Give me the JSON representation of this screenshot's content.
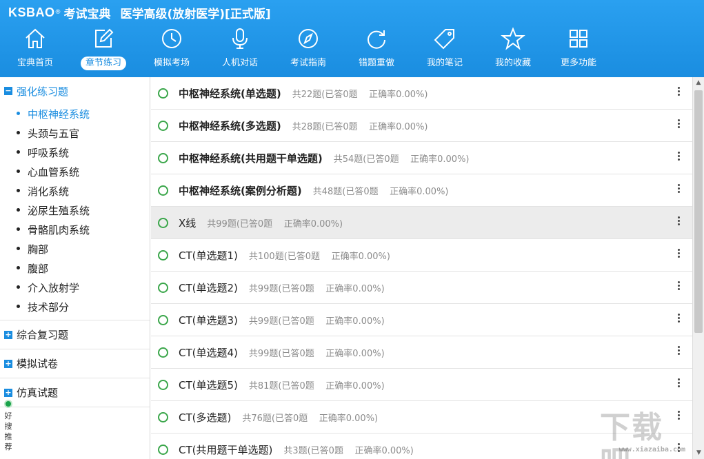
{
  "brand": {
    "logo": "KSBAO",
    "logo_sup": "®",
    "logo_cn": "考试宝典",
    "app_title": "医学高级(放射医学)[正式版]"
  },
  "nav": [
    {
      "label": "宝典首页",
      "icon": "home-icon"
    },
    {
      "label": "章节练习",
      "icon": "edit-icon"
    },
    {
      "label": "模拟考场",
      "icon": "clock-icon"
    },
    {
      "label": "人机对话",
      "icon": "microphone-icon"
    },
    {
      "label": "考试指南",
      "icon": "compass-icon"
    },
    {
      "label": "错题重做",
      "icon": "refresh-icon"
    },
    {
      "label": "我的笔记",
      "icon": "tag-icon"
    },
    {
      "label": "我的收藏",
      "icon": "star-icon"
    },
    {
      "label": "更多功能",
      "icon": "grid-icon"
    }
  ],
  "nav_active": "章节练习",
  "sidebar": {
    "groups": [
      {
        "title": "强化练习题",
        "toggle": "−",
        "items": [
          "中枢神经系统",
          "头颈与五官",
          "呼吸系统",
          "心血管系统",
          "消化系统",
          "泌尿生殖系统",
          "骨骼肌肉系统",
          "胸部",
          "腹部",
          "介入放射学",
          "技术部分"
        ]
      },
      {
        "title": "综合复习题",
        "toggle": "+"
      },
      {
        "title": "模拟试卷",
        "toggle": "+"
      },
      {
        "title": "仿真试题",
        "toggle": "+"
      }
    ],
    "recommend": "好搜推荐"
  },
  "rows": [
    {
      "name": "中枢神经系统(单选题)",
      "stat": "共22题(已答0题    正确率0.00%)"
    },
    {
      "name": "中枢神经系统(多选题)",
      "stat": "共28题(已答0题    正确率0.00%)"
    },
    {
      "name": "中枢神经系统(共用题干单选题)",
      "stat": "共54题(已答0题    正确率0.00%)"
    },
    {
      "name": "中枢神经系统(案例分析题)",
      "stat": "共48题(已答0题    正确率0.00%)"
    },
    {
      "name": "X线",
      "stat": "共99题(已答0题    正确率0.00%)"
    },
    {
      "name": "CT(单选题1)",
      "stat": "共100题(已答0题    正确率0.00%)"
    },
    {
      "name": "CT(单选题2)",
      "stat": "共99题(已答0题    正确率0.00%)"
    },
    {
      "name": "CT(单选题3)",
      "stat": "共99题(已答0题    正确率0.00%)"
    },
    {
      "name": "CT(单选题4)",
      "stat": "共99题(已答0题    正确率0.00%)"
    },
    {
      "name": "CT(单选题5)",
      "stat": "共81题(已答0题    正确率0.00%)"
    },
    {
      "name": "CT(多选题)",
      "stat": "共76题(已答0题    正确率0.00%)"
    },
    {
      "name": "CT(共用题干单选题)",
      "stat": "共3题(已答0题    正确率0.00%)"
    }
  ],
  "watermark": {
    "big": "下载吧",
    "small": "www.xiazaiba.com"
  },
  "colors": {
    "accent": "#1a8de0",
    "circle": "#3aa64a"
  }
}
